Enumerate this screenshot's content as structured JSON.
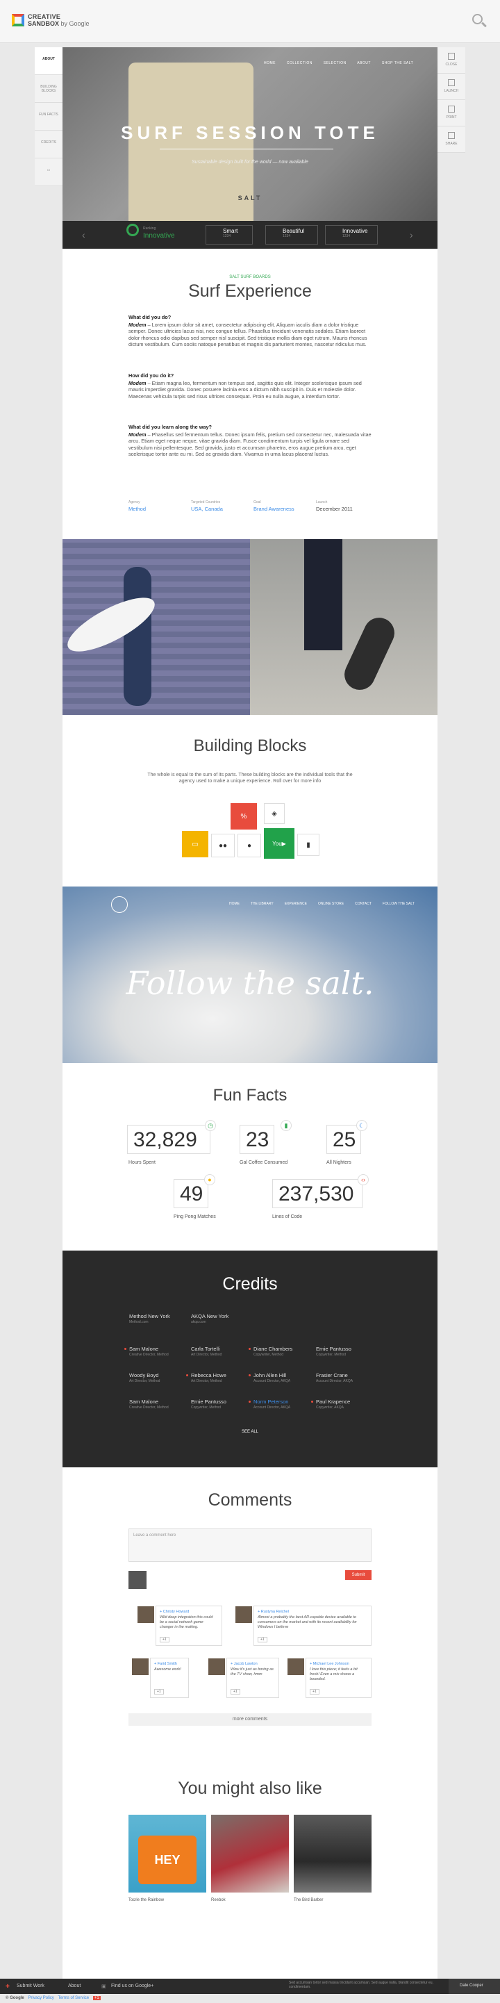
{
  "header": {
    "brand_line1": "CREATIVE",
    "brand_line2": "SANDBOX",
    "brand_by": "by Google"
  },
  "left_nav": {
    "items": [
      "ABOUT",
      "BUILDING BLOCKS",
      "FUN FACTS",
      "CREDITS"
    ]
  },
  "right_nav": {
    "items": [
      "CLOSE",
      "LAUNCH",
      "PRINT",
      "SHARE"
    ]
  },
  "hero": {
    "title": "SURF SESSION TOTE",
    "subtitle": "Sustainable design built for the world — now available",
    "bag_text": "SALT",
    "menu": [
      "HOME",
      "COLLECTION",
      "SELECTION",
      "ABOUT",
      "SHOP THE SALT"
    ]
  },
  "rating": {
    "current_label": "Ranking",
    "current_value": "Innovative",
    "options": [
      {
        "label": "Smart",
        "sub": "1234"
      },
      {
        "label": "Beautiful",
        "sub": "1234"
      },
      {
        "label": "Innovative",
        "sub": "1234"
      }
    ]
  },
  "project": {
    "kicker": "SALT SURF BOARDS",
    "title": "Surf Experience",
    "sections": [
      {
        "q": "What did you do?",
        "lead": "Modem",
        "text": " – Lorem ipsum dolor sit amet, consectetur adipiscing elit. Aliquam iaculis diam a dolor tristique semper. Donec ultricies lacus nisi, nec congue tellus. Phasellus tincidunt venenatis sodales. Etiam laoreet dolor rhoncus odio dapibus sed semper nisl suscipit. Sed tristique mollis diam eget rutrum. Mauris rhoncus dictum vestibulum. Cum sociis natoque penatibus et magnis dis parturient montes, nascetur ridiculus mus."
      },
      {
        "q": "How did you do it?",
        "lead": "Modem",
        "text": " – Etiam magna leo, fermentum non tempus sed, sagittis quis elit. Integer scelerisque ipsum sed mauris imperdiet gravida. Donec posuere lacinia eros a dictum nibh suscipit in. Duis et molestie dolor. Maecenas vehicula turpis sed risus ultrices consequat. Proin eu nulla augue, a interdum tortor."
      },
      {
        "q": "What did you learn along the way?",
        "lead": "Modem",
        "text": " – Phasellus sed fermentum tellus. Donec ipsum felis, pretium sed consectetur nec, malesuada vitae arcu. Etiam eget neque neque, vitae gravida diam. Fusce condimentum turpis vel ligula ornare sed vestibulum nisi pellentesque. Sed gravida, justo et accumsan pharetra, eros augue pretium arcu, eget scelerisque tortor ante eu mi. Sed ac gravida diam. Vivamus in urna lacus placerat luctus."
      }
    ],
    "meta": [
      {
        "label": "Agency",
        "value": "Method"
      },
      {
        "label": "Targeted Countries",
        "value": "USA, Canada"
      },
      {
        "label": "Goal",
        "value": "Brand Awareness"
      },
      {
        "label": "Launch",
        "value": "December 2011"
      }
    ]
  },
  "building_blocks": {
    "title": "Building Blocks",
    "text": "The whole is equal to the sum of its parts. These building blocks are the individual tools that the agency used to make a unique experience. Roll over for more info"
  },
  "campaign": {
    "script": "Follow the salt.",
    "menu": [
      "HOME",
      "THE LIBRARY",
      "EXPERIENCE",
      "ONLINE STORE",
      "CONTACT",
      "FOLLOW THE SALT"
    ]
  },
  "fun_facts": {
    "title": "Fun Facts",
    "stats": [
      {
        "value": "32,829",
        "label": "Hours Spent"
      },
      {
        "value": "23",
        "label": "Gal Coffee Consumed"
      },
      {
        "value": "25",
        "label": "All Nighters"
      },
      {
        "value": "49",
        "label": "Ping Pong Matches"
      },
      {
        "value": "237,530",
        "label": "Lines of Code"
      }
    ]
  },
  "credits": {
    "title": "Credits",
    "agencies": [
      {
        "name": "Method New York",
        "role": "Method.com"
      },
      {
        "name": "AKQA New York",
        "role": "akqa.com"
      }
    ],
    "people": [
      {
        "name": "Sam Malone",
        "role": "Creative Director, Method"
      },
      {
        "name": "Carla Tortelli",
        "role": "Art Director, Method"
      },
      {
        "name": "Diane Chambers",
        "role": "Copywriter, Method"
      },
      {
        "name": "Ernie Pantusso",
        "role": "Copywriter, Method"
      },
      {
        "name": "Woody Boyd",
        "role": "Art Director, Method"
      },
      {
        "name": "Rebecca Howe",
        "role": "Art Director, Method"
      },
      {
        "name": "John Allen Hill",
        "role": "Account Director, AKQA"
      },
      {
        "name": "Frasier Crane",
        "role": "Account Director, AKQA"
      },
      {
        "name": "Sam Malone",
        "role": "Creative Director, Method"
      },
      {
        "name": "Ernie Pantusso",
        "role": "Copywriter, Method"
      },
      {
        "name": "Norm Peterson",
        "role": "Account Director, AKQA"
      },
      {
        "name": "Paul Krapence",
        "role": "Copywriter, AKQA"
      }
    ],
    "see_all": "SEE ALL"
  },
  "comments": {
    "title": "Comments",
    "placeholder": "Leave a comment here",
    "submit": "Submit",
    "items": [
      {
        "name": "+ Christy Howard",
        "text": "Wild deep integration this could be a social network game-changer in the making.",
        "count": "+1"
      },
      {
        "name": "+ Rustyna Reichel",
        "text": "Almost a probably the best AR-capable device available to consumers on the market and with its recent availability for Windows I believe",
        "count": "+1"
      },
      {
        "name": "+ Farid Smith",
        "text": "Awesome work!",
        "count": "+1"
      },
      {
        "name": "+ Jacob Lawton",
        "text": "Wow it's just as boring as the TV show, hmm",
        "count": "+1"
      },
      {
        "name": "+ Michael Lee Johnson",
        "text": "I love this piece; it feels a bit fresh! Even a mix shows a bounded.",
        "count": "+1"
      }
    ],
    "more": "more comments"
  },
  "related": {
    "title": "You might also like",
    "items": [
      {
        "label": "Tocrie the Rainbow",
        "tile_text": "HEY"
      },
      {
        "label": "Reebok"
      },
      {
        "label": "The Bird Barber"
      }
    ]
  },
  "footer": {
    "submit": "Submit Work",
    "about": "About",
    "find": "Find us on Google+",
    "text": "Sed accumsan tortor sed massa tincidunt accumsan. Sed augue nulla, blandit consectetur eu, condimentum.",
    "user": "Dale Cooper"
  },
  "bottom": {
    "copyright": "© Google",
    "privacy": "Privacy Policy",
    "terms": "Terms of Service",
    "gplus": "+1"
  }
}
